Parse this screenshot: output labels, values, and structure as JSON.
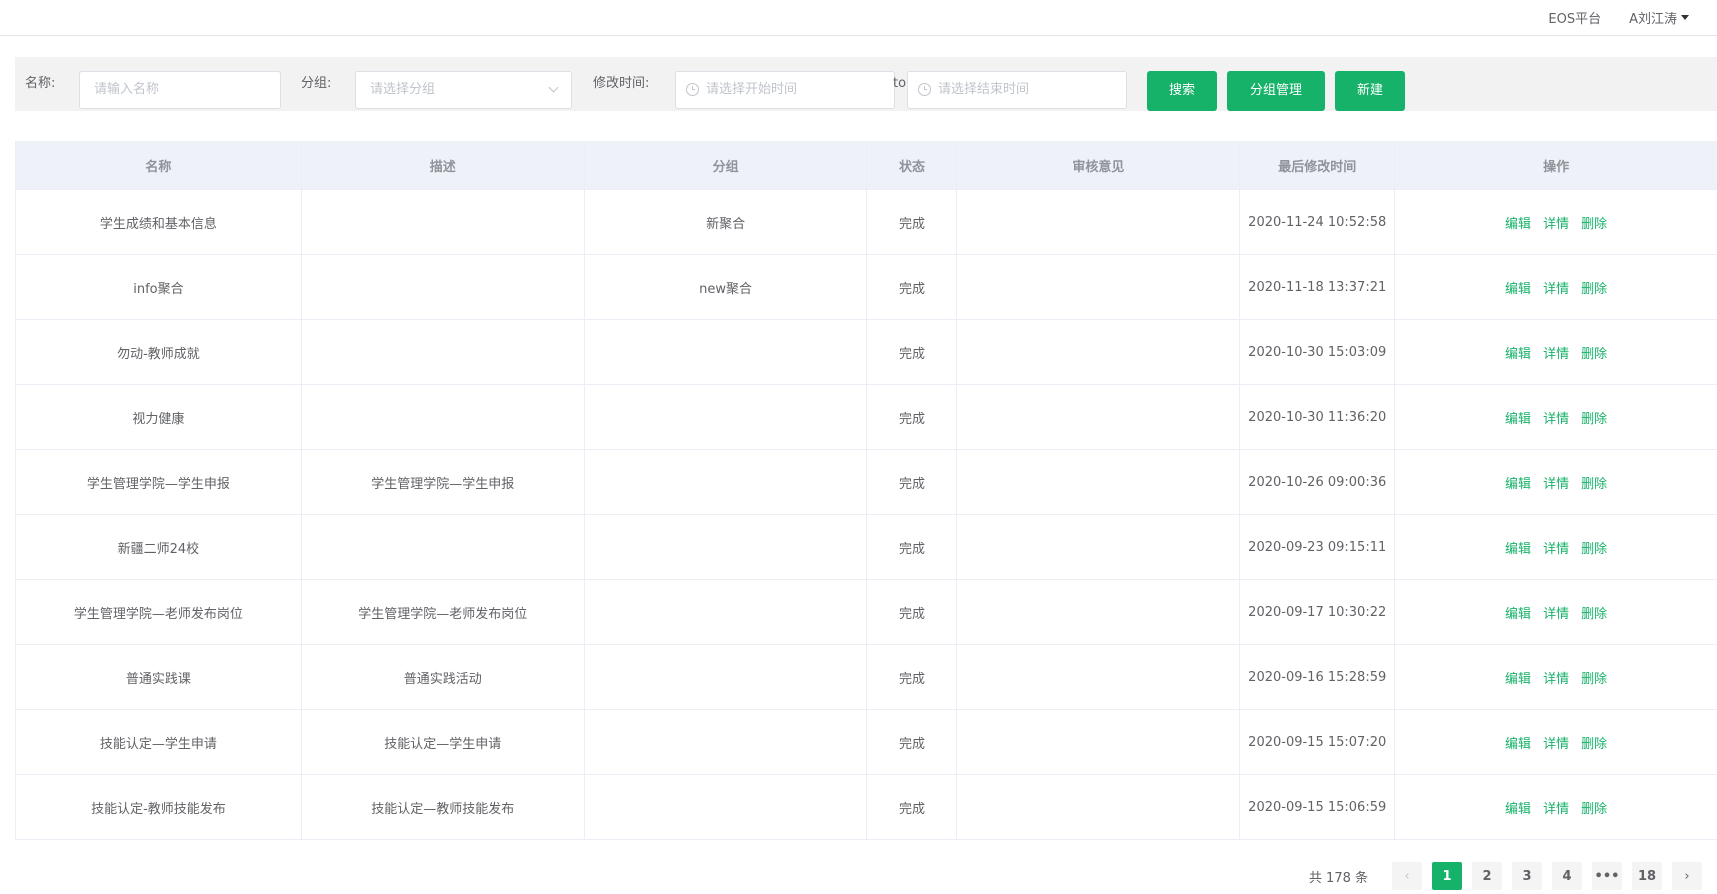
{
  "topbar": {
    "platform": "EOS平台",
    "user": "A刘江涛"
  },
  "filter": {
    "name_label": "名称:",
    "name_placeholder": "请输入名称",
    "group_label": "分组:",
    "group_placeholder": "请选择分组",
    "time_label": "修改时间:",
    "start_placeholder": "请选择开始时间",
    "to_label": "to",
    "end_placeholder": "请选择结束时间",
    "search_button": "搜索",
    "group_manage_button": "分组管理",
    "create_button": "新建"
  },
  "table": {
    "columns": [
      "名称",
      "描述",
      "分组",
      "状态",
      "审核意见",
      "最后修改时间",
      "操作"
    ],
    "actions": [
      "编辑",
      "详情",
      "删除"
    ],
    "rows": [
      {
        "name": "学生成绩和基本信息",
        "desc": "",
        "group": "新聚合",
        "status": "完成",
        "review": "",
        "time": "2020-11-24 10:52:58"
      },
      {
        "name": "info聚合",
        "desc": "",
        "group": "new聚合",
        "status": "完成",
        "review": "",
        "time": "2020-11-18 13:37:21"
      },
      {
        "name": "勿动-教师成就",
        "desc": "",
        "group": "",
        "status": "完成",
        "review": "",
        "time": "2020-10-30 15:03:09"
      },
      {
        "name": "视力健康",
        "desc": "",
        "group": "",
        "status": "完成",
        "review": "",
        "time": "2020-10-30 11:36:20"
      },
      {
        "name": "学生管理学院—学生申报",
        "desc": "学生管理学院—学生申报",
        "group": "",
        "status": "完成",
        "review": "",
        "time": "2020-10-26 09:00:36"
      },
      {
        "name": "新疆二师24校",
        "desc": "",
        "group": "",
        "status": "完成",
        "review": "",
        "time": "2020-09-23 09:15:11"
      },
      {
        "name": "学生管理学院—老师发布岗位",
        "desc": "学生管理学院—老师发布岗位",
        "group": "",
        "status": "完成",
        "review": "",
        "time": "2020-09-17 10:30:22"
      },
      {
        "name": "普通实践课",
        "desc": "普通实践活动",
        "group": "",
        "status": "完成",
        "review": "",
        "time": "2020-09-16 15:28:59"
      },
      {
        "name": "技能认定—学生申请",
        "desc": "技能认定—学生申请",
        "group": "",
        "status": "完成",
        "review": "",
        "time": "2020-09-15 15:07:20"
      },
      {
        "name": "技能认定-教师技能发布",
        "desc": "技能认定—教师技能发布",
        "group": "",
        "status": "完成",
        "review": "",
        "time": "2020-09-15 15:06:59"
      }
    ]
  },
  "pagination": {
    "total": "共 178 条",
    "prev": "‹",
    "pages": [
      "1",
      "2",
      "3",
      "4",
      "•••",
      "18"
    ],
    "next": "›"
  },
  "colors": {
    "accent": "#17b26a",
    "header_bg": "#eef2f8",
    "filter_bg": "#f2f2f2"
  }
}
